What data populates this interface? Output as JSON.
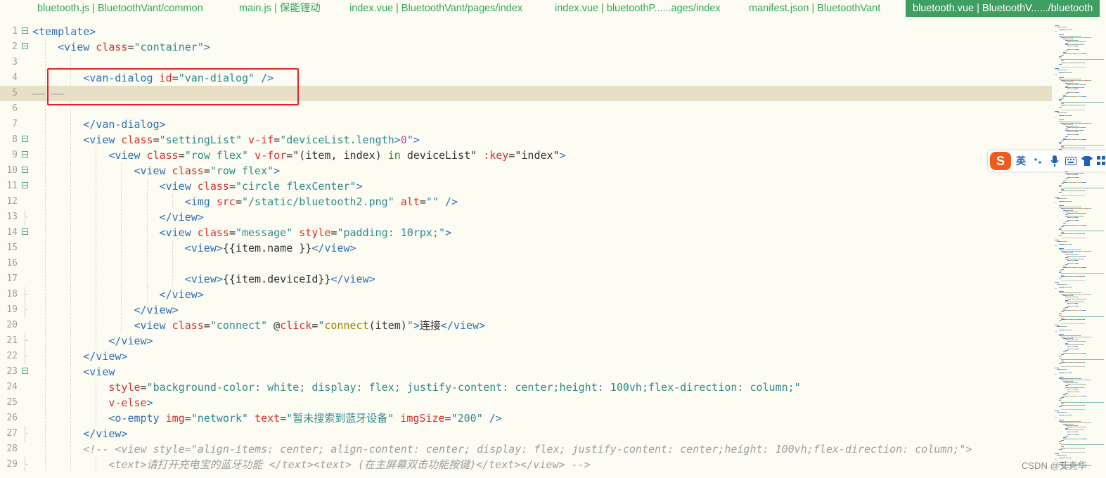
{
  "tabs": [
    {
      "label": "bluetooth.js | BluetoothVant/common"
    },
    {
      "label": "main.js | 保能锂动"
    },
    {
      "label": "index.vue | BluetoothVant/pages/index"
    },
    {
      "label": "index.vue | bluetoothP......ages/index"
    },
    {
      "label": "manifest.json | BluetoothVant"
    },
    {
      "label": "bluetooth.vue | BluetoothV....../bluetooth",
      "active": true
    }
  ],
  "editor": {
    "lines": [
      {
        "n": "1",
        "fold": "open",
        "indent": 0,
        "tokens": [
          [
            "tg",
            "<template>"
          ]
        ]
      },
      {
        "n": "2",
        "fold": "open",
        "indent": 1,
        "tokens": [
          [
            "tg",
            "<view "
          ],
          [
            "at",
            "class"
          ],
          [
            "tx",
            "="
          ],
          [
            "st",
            "\"container\""
          ],
          [
            "tg",
            ">"
          ]
        ]
      },
      {
        "n": "3",
        "fold": "none",
        "indent": 2,
        "tokens": []
      },
      {
        "n": "4",
        "fold": "none",
        "indent": 2,
        "tokens": [
          [
            "tg",
            "<van-dialog "
          ],
          [
            "at",
            "id"
          ],
          [
            "tx",
            "="
          ],
          [
            "st",
            "\"van-dialog\""
          ],
          [
            "tg",
            " />"
          ]
        ]
      },
      {
        "n": "5",
        "fold": "none",
        "indent": 0,
        "highlight": true,
        "tokens": [
          [
            "cm",
            "—— ——"
          ]
        ]
      },
      {
        "n": "6",
        "fold": "none",
        "indent": 2,
        "tokens": []
      },
      {
        "n": "7",
        "fold": "none",
        "indent": 2,
        "tokens": [
          [
            "tg",
            "</van-dialog>"
          ]
        ]
      },
      {
        "n": "8",
        "fold": "open",
        "indent": 2,
        "tokens": [
          [
            "tg",
            "<view "
          ],
          [
            "at",
            "class"
          ],
          [
            "tx",
            "="
          ],
          [
            "st",
            "\"settingList\""
          ],
          [
            "tx",
            " "
          ],
          [
            "at",
            "v-if"
          ],
          [
            "tx",
            "="
          ],
          [
            "st",
            "\"deviceList.length>"
          ],
          [
            "nm",
            "0"
          ],
          [
            "st",
            "\""
          ],
          [
            "tg",
            ">"
          ]
        ]
      },
      {
        "n": "9",
        "fold": "open",
        "indent": 3,
        "tokens": [
          [
            "tg",
            "<view "
          ],
          [
            "at",
            "class"
          ],
          [
            "tx",
            "="
          ],
          [
            "st",
            "\"row flex\""
          ],
          [
            "tx",
            " "
          ],
          [
            "at",
            "v-for"
          ],
          [
            "tx",
            "="
          ],
          [
            "tx",
            "\"(item, index) "
          ],
          [
            "kw",
            "in"
          ],
          [
            "tx",
            " deviceList\""
          ],
          [
            "tx",
            " "
          ],
          [
            "at",
            ":key"
          ],
          [
            "tx",
            "="
          ],
          [
            "tx",
            "\"index\""
          ],
          [
            "tg",
            ">"
          ]
        ]
      },
      {
        "n": "10",
        "fold": "open",
        "indent": 4,
        "tokens": [
          [
            "tg",
            "<view "
          ],
          [
            "at",
            "class"
          ],
          [
            "tx",
            "="
          ],
          [
            "st",
            "\"row flex\""
          ],
          [
            "tg",
            ">"
          ]
        ]
      },
      {
        "n": "11",
        "fold": "open",
        "indent": 5,
        "tokens": [
          [
            "tg",
            "<view "
          ],
          [
            "at",
            "class"
          ],
          [
            "tx",
            "="
          ],
          [
            "st",
            "\"circle flexCenter\""
          ],
          [
            "tg",
            ">"
          ]
        ]
      },
      {
        "n": "12",
        "fold": "none",
        "indent": 6,
        "tokens": [
          [
            "tg",
            "<img "
          ],
          [
            "at",
            "src"
          ],
          [
            "tx",
            "="
          ],
          [
            "st",
            "\"/static/bluetooth2.png\""
          ],
          [
            "tx",
            " "
          ],
          [
            "at",
            "alt"
          ],
          [
            "tx",
            "="
          ],
          [
            "st",
            "\"\""
          ],
          [
            "tg",
            " />"
          ]
        ]
      },
      {
        "n": "13",
        "fold": "end",
        "indent": 5,
        "tokens": [
          [
            "tg",
            "</view>"
          ]
        ]
      },
      {
        "n": "14",
        "fold": "open",
        "indent": 5,
        "tokens": [
          [
            "tg",
            "<view "
          ],
          [
            "at",
            "class"
          ],
          [
            "tx",
            "="
          ],
          [
            "st",
            "\"message\""
          ],
          [
            "tx",
            " "
          ],
          [
            "at",
            "style"
          ],
          [
            "tx",
            "="
          ],
          [
            "st",
            "\"padding: 10rpx;\""
          ],
          [
            "tg",
            ">"
          ]
        ]
      },
      {
        "n": "15",
        "fold": "none",
        "indent": 6,
        "tokens": [
          [
            "tg",
            "<view>"
          ],
          [
            "tx",
            "{{item.name }}"
          ],
          [
            "tg",
            "</view>"
          ]
        ]
      },
      {
        "n": "16",
        "fold": "none",
        "indent": 6,
        "tokens": []
      },
      {
        "n": "17",
        "fold": "none",
        "indent": 6,
        "tokens": [
          [
            "tg",
            "<view>"
          ],
          [
            "tx",
            "{{item.deviceId}}"
          ],
          [
            "tg",
            "</view>"
          ]
        ]
      },
      {
        "n": "18",
        "fold": "end",
        "indent": 5,
        "tokens": [
          [
            "tg",
            "</view>"
          ]
        ]
      },
      {
        "n": "19",
        "fold": "end",
        "indent": 4,
        "tokens": [
          [
            "tg",
            "</view>"
          ]
        ]
      },
      {
        "n": "20",
        "fold": "none",
        "indent": 4,
        "tokens": [
          [
            "tg",
            "<view "
          ],
          [
            "at",
            "class"
          ],
          [
            "tx",
            "="
          ],
          [
            "st",
            "\"connect\""
          ],
          [
            "tx",
            " "
          ],
          [
            "tx",
            "@"
          ],
          [
            "at",
            "click"
          ],
          [
            "tx",
            "="
          ],
          [
            "st",
            "\""
          ],
          [
            "ev",
            "connect"
          ],
          [
            "tx",
            "(item)"
          ],
          [
            "st",
            "\""
          ],
          [
            "tg",
            ">"
          ],
          [
            "tx",
            "连接"
          ],
          [
            "tg",
            "</view>"
          ]
        ]
      },
      {
        "n": "21",
        "fold": "end",
        "indent": 3,
        "tokens": [
          [
            "tg",
            "</view>"
          ]
        ]
      },
      {
        "n": "22",
        "fold": "end",
        "indent": 2,
        "tokens": [
          [
            "tg",
            "</view>"
          ]
        ]
      },
      {
        "n": "23",
        "fold": "open",
        "indent": 2,
        "tokens": [
          [
            "tg",
            "<view"
          ]
        ]
      },
      {
        "n": "24",
        "fold": "none",
        "indent": 3,
        "tokens": [
          [
            "at",
            "style"
          ],
          [
            "tx",
            "="
          ],
          [
            "st",
            "\"background-color: white; display: flex; justify-content: center;height: 100vh;flex-direction: column;\""
          ]
        ]
      },
      {
        "n": "25",
        "fold": "none",
        "indent": 3,
        "tokens": [
          [
            "at",
            "v-else"
          ],
          [
            "tg",
            ">"
          ]
        ]
      },
      {
        "n": "26",
        "fold": "none",
        "indent": 3,
        "tokens": [
          [
            "tg",
            "<o-empty "
          ],
          [
            "at",
            "img"
          ],
          [
            "tx",
            "="
          ],
          [
            "st",
            "\"network\""
          ],
          [
            "tx",
            " "
          ],
          [
            "at",
            "text"
          ],
          [
            "tx",
            "="
          ],
          [
            "st",
            "\"暂未搜索到蓝牙设备\""
          ],
          [
            "tx",
            " "
          ],
          [
            "at",
            "imgSize"
          ],
          [
            "tx",
            "="
          ],
          [
            "st",
            "\"200\""
          ],
          [
            "tg",
            " />"
          ]
        ]
      },
      {
        "n": "27",
        "fold": "end",
        "indent": 2,
        "tokens": [
          [
            "tg",
            "</view>"
          ]
        ]
      },
      {
        "n": "28",
        "fold": "none",
        "indent": 2,
        "tokens": [
          [
            "cm",
            "<!-- <view style=\"align-items: center; align-content: center; display: flex; justify-content: center;height: 100vh;flex-direction: column;\">"
          ]
        ]
      },
      {
        "n": "29",
        "fold": "end",
        "indent": 3,
        "tokens": [
          [
            "cm",
            "<text>请打开充电宝的蓝牙功能 </text><text> (在主屏幕双击功能按键)</text></view> -->"
          ]
        ]
      }
    ]
  },
  "ime": {
    "logo": "S",
    "mode_label": "英",
    "punct_icon": "punctuation-icon",
    "mic_icon": "microphone-icon",
    "keyboard_icon": "keyboard-icon",
    "skin_icon": "shirt-icon",
    "toolbox_icon": "grid-icon"
  },
  "watermark": "CSDN @艾克华",
  "colors": {
    "tab_text": "#35a35a",
    "tab_active_bg": "#3f9e61",
    "editor_bg": "#fdfcf3",
    "current_line": "#e8e0c6",
    "tag": "#2f6fb2",
    "attr": "#d22f2f",
    "string": "#2e8a8a",
    "annotation_box": "#e8202a",
    "ime_logo": "#f05a1a"
  }
}
